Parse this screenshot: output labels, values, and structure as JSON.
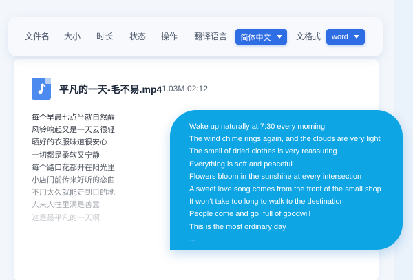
{
  "toolbar": {
    "file_name_label": "文件名",
    "size_label": "大小",
    "duration_label": "时长",
    "status_label": "状态",
    "action_label": "操作",
    "translate_language_label": "翻译语言",
    "language_select_value": "简体中文",
    "doc_format_label": "文格式",
    "format_select_value": "word"
  },
  "file": {
    "icon": "music-note-icon",
    "name": "平凡的一天-毛不易.mp4",
    "size": "1.03M",
    "duration": "02:12"
  },
  "transcript_cn": [
    "每个早晨七点半就自然醒",
    "风铃响起又是一天云很轻",
    "晒好的衣服味道很安心",
    "一切都是柔软又宁静",
    "每个路口花都开在阳光里",
    "小店门前传来好听的恋曲",
    "不用太久就能走到目的地",
    "人来人往里满是善意",
    "这是最平凡的一天啊"
  ],
  "transcript_en": [
    "Wake up naturally at 7:30 every morning",
    "The wind chime rings again, and the clouds are very light",
    "The smell of dried clothes is very reassuring",
    "Everything is soft and peaceful",
    "Flowers bloom in the sunshine at every intersection",
    "A sweet love song comes from the front of the small shop",
    "It won't take too long to walk to the destination",
    "People come and go, full of goodwill",
    "This is the most ordinary day",
    "..."
  ],
  "colors": {
    "accent": "#2f6de5",
    "bubble": "#0ea5e5"
  }
}
